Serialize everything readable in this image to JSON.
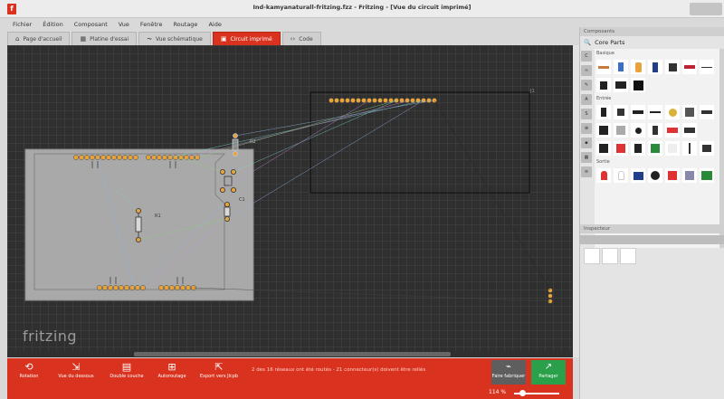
{
  "window": {
    "title": "Ind-kamyanaturall-fritzing.fzz - Fritzing - [Vue du circuit imprimé]"
  },
  "menu": [
    "Fichier",
    "Édition",
    "Composant",
    "Vue",
    "Fenêtre",
    "Routage",
    "Aide"
  ],
  "tabs": [
    {
      "label": "Page d'accueil",
      "icon": "home-icon",
      "active": false
    },
    {
      "label": "Platine d'essai",
      "icon": "breadboard-icon",
      "active": false
    },
    {
      "label": "Vue schématique",
      "icon": "schematic-icon",
      "active": false
    },
    {
      "label": "Circuit imprimé",
      "icon": "pcb-icon",
      "active": true
    },
    {
      "label": "Code",
      "icon": "code-icon",
      "active": false
    }
  ],
  "canvas": {
    "logo": "fritzing",
    "labels": {
      "r1": "R1",
      "r2": "R2",
      "c1": "C1",
      "header": "J1"
    }
  },
  "toolbar": {
    "tools": [
      {
        "label": "Rotation",
        "icon": "rotate-icon"
      },
      {
        "label": "Vue du dessous",
        "icon": "view-below-icon"
      },
      {
        "label": "Double couche",
        "icon": "layers-icon"
      },
      {
        "label": "Autoroutage",
        "icon": "autoroute-icon"
      },
      {
        "label": "Export vers Jlcpb",
        "icon": "export-icon"
      }
    ],
    "status": "2 des 16 réseaux ont été routés - 21 connecteur(s) doivent être reliés",
    "fab_label": "Faire fabriquer",
    "share_label": "Partager"
  },
  "statusbar": {
    "zoom": "114 %"
  },
  "components_panel": {
    "header": "Composants",
    "search_label": "Core Parts",
    "sections": [
      "Basique",
      "Entrée",
      "Sortie"
    ]
  },
  "inspector": {
    "header": "Inspecteur"
  },
  "colors": {
    "accent": "#d9321f",
    "share_green": "#2aa04a",
    "canvas_bg": "#2f2f2f",
    "board": "#a9a9a9"
  }
}
